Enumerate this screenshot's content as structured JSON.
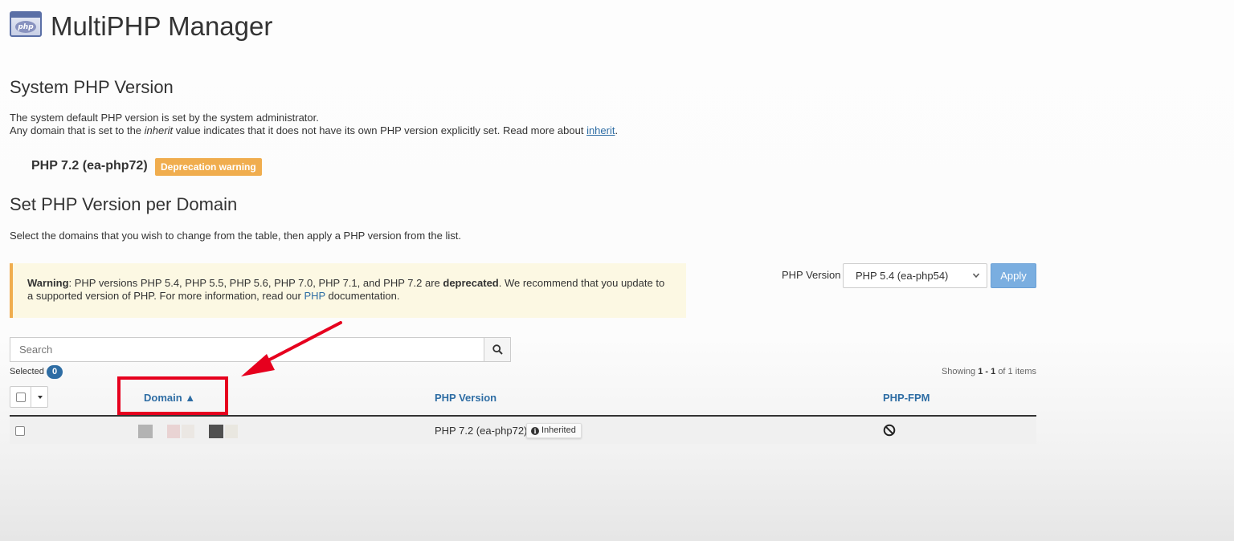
{
  "header": {
    "title": "MultiPHP Manager",
    "logo_icon": "php-icon",
    "logo_text": "php"
  },
  "system": {
    "heading": "System PHP Version",
    "line1": "The system default PHP version is set by the system administrator.",
    "line2_pre": "Any domain that is set to the ",
    "line2_em": "inherit",
    "line2_mid": " value indicates that it does not have its own PHP version explicitly set. Read more about ",
    "line2_link": "inherit",
    "line2_post": ".",
    "current_version": "PHP 7.2 (ea-php72)",
    "badge": "Deprecation warning"
  },
  "per_domain": {
    "heading": "Set PHP Version per Domain",
    "instructions": "Select the domains that you wish to change from the table, then apply a PHP version from the list."
  },
  "alert": {
    "strong": "Warning",
    "text1": ": PHP versions PHP 5.4, PHP 5.5, PHP 5.6, PHP 7.0, PHP 7.1, and PHP 7.2 are ",
    "strong2": "deprecated",
    "text2": ". We recommend that you update to a supported version of PHP. For more information, read our ",
    "link": "PHP",
    "text3": " documentation."
  },
  "version_select": {
    "label": "PHP Version",
    "value": "PHP 5.4 (ea-php54)",
    "apply": "Apply"
  },
  "search": {
    "placeholder": "Search"
  },
  "selection": {
    "label": "Selected",
    "count": "0"
  },
  "pagination": {
    "prefix": "Showing",
    "range": "1 - 1",
    "suffix": "of 1 items"
  },
  "table": {
    "columns": {
      "domain": "Domain ▲",
      "php_version": "PHP Version",
      "php_fpm": "PHP-FPM"
    },
    "rows": [
      {
        "php_version": "PHP 7.2 (ea-php72)",
        "inherited_label": "Inherited",
        "php_fpm_icon": "ban-icon"
      }
    ]
  },
  "colors": {
    "link": "#2e6da4",
    "warning": "#f0ad4e",
    "alert_bg": "#fcf8e3",
    "apply": "#7aaee0",
    "annotation": "#e6001e"
  }
}
